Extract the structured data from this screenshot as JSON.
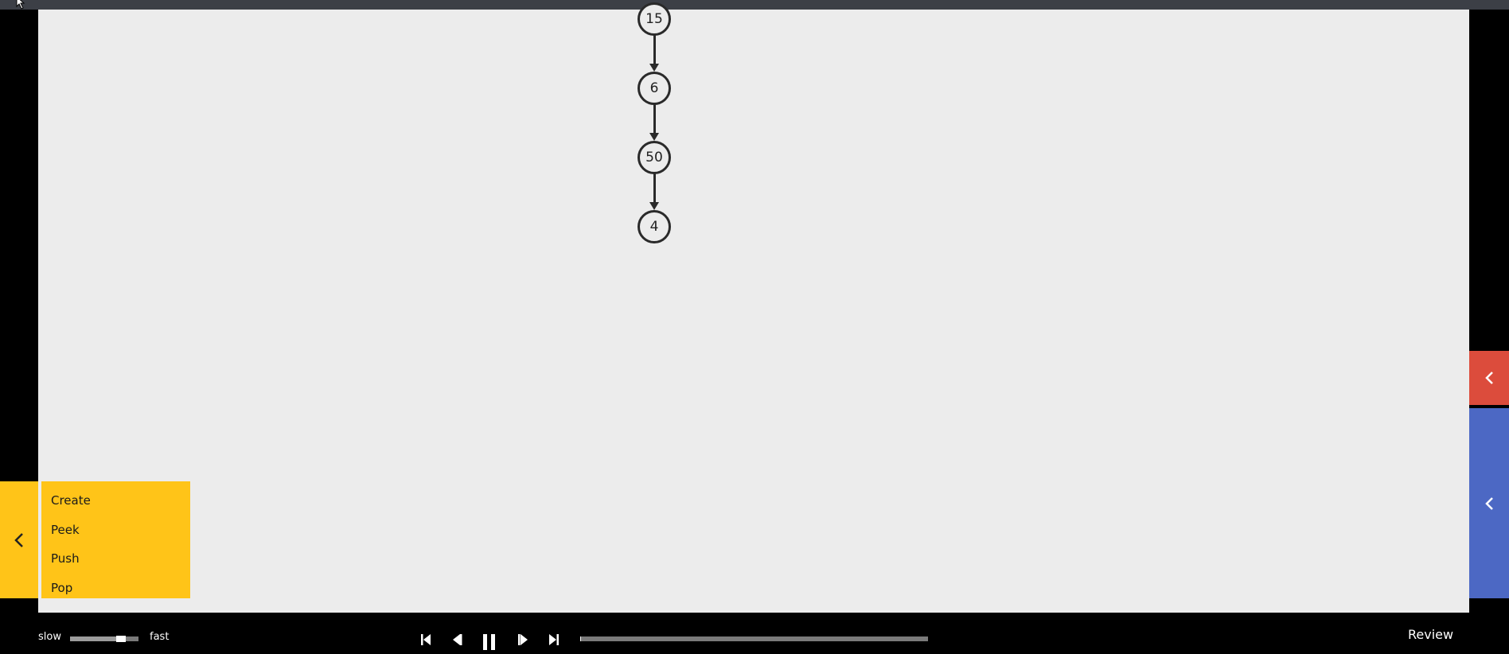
{
  "graph": {
    "nodes": [
      "15",
      "6",
      "50",
      "4"
    ]
  },
  "left_menu": {
    "items": [
      "Create",
      "Peek",
      "Push",
      "Pop"
    ]
  },
  "speed": {
    "slow_label": "slow",
    "fast_label": "fast",
    "level": 0.78
  },
  "playback": {
    "progress": 0.003
  },
  "review_label": "Review",
  "colors": {
    "canvas": "#ececec",
    "yellow_panel": "#ffc418",
    "red_panel": "#dc4c3c",
    "blue_panel": "#4c68c4",
    "node_stroke": "#2a2a2a"
  },
  "icons": {
    "yellow_tab": "chevron-left-icon",
    "red_tab": "chevron-left-icon",
    "blue_tab": "chevron-left-icon",
    "controls": [
      "skip-to-start-icon",
      "step-back-icon",
      "pause-icon",
      "step-forward-icon",
      "skip-to-end-icon"
    ]
  }
}
